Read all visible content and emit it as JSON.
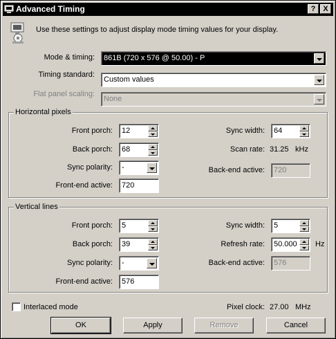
{
  "window": {
    "title": "Advanced Timing",
    "help_button": "?",
    "close_button": "X"
  },
  "intro_text": "Use these settings to adjust display mode timing values for your display.",
  "mode_timing": {
    "label": "Mode & timing:",
    "value": "861B  (720 x 576 @ 50.00) - P"
  },
  "timing_standard": {
    "label": "Timing standard:",
    "value": "Custom values"
  },
  "flat_panel_scaling": {
    "label": "Flat panel scaling:",
    "value": "None"
  },
  "horizontal": {
    "group_title": "Horizontal pixels",
    "front_porch": {
      "label": "Front porch:",
      "value": "12"
    },
    "back_porch": {
      "label": "Back porch:",
      "value": "68"
    },
    "sync_polarity": {
      "label": "Sync polarity:",
      "value": "-"
    },
    "front_end_active": {
      "label": "Front-end active:",
      "value": "720"
    },
    "sync_width": {
      "label": "Sync width:",
      "value": "64"
    },
    "scan_rate": {
      "label": "Scan rate:",
      "value": "31.25",
      "unit": "kHz"
    },
    "back_end_active": {
      "label": "Back-end active:",
      "value": "720"
    }
  },
  "vertical": {
    "group_title": "Vertical lines",
    "front_porch": {
      "label": "Front porch:",
      "value": "5"
    },
    "back_porch": {
      "label": "Back porch:",
      "value": "39"
    },
    "sync_polarity": {
      "label": "Sync polarity:",
      "value": "-"
    },
    "front_end_active": {
      "label": "Front-end active:",
      "value": "576"
    },
    "sync_width": {
      "label": "Sync width:",
      "value": "5"
    },
    "refresh_rate": {
      "label": "Refresh rate:",
      "value": "50.000",
      "unit": "Hz"
    },
    "back_end_active": {
      "label": "Back-end active:",
      "value": "576"
    }
  },
  "interlaced": {
    "label": "Interlaced mode",
    "checked": false
  },
  "pixel_clock": {
    "label": "Pixel clock:",
    "value": "27.00",
    "unit": "MHz"
  },
  "buttons": {
    "ok": "OK",
    "apply": "Apply",
    "remove": "Remove",
    "cancel": "Cancel"
  }
}
